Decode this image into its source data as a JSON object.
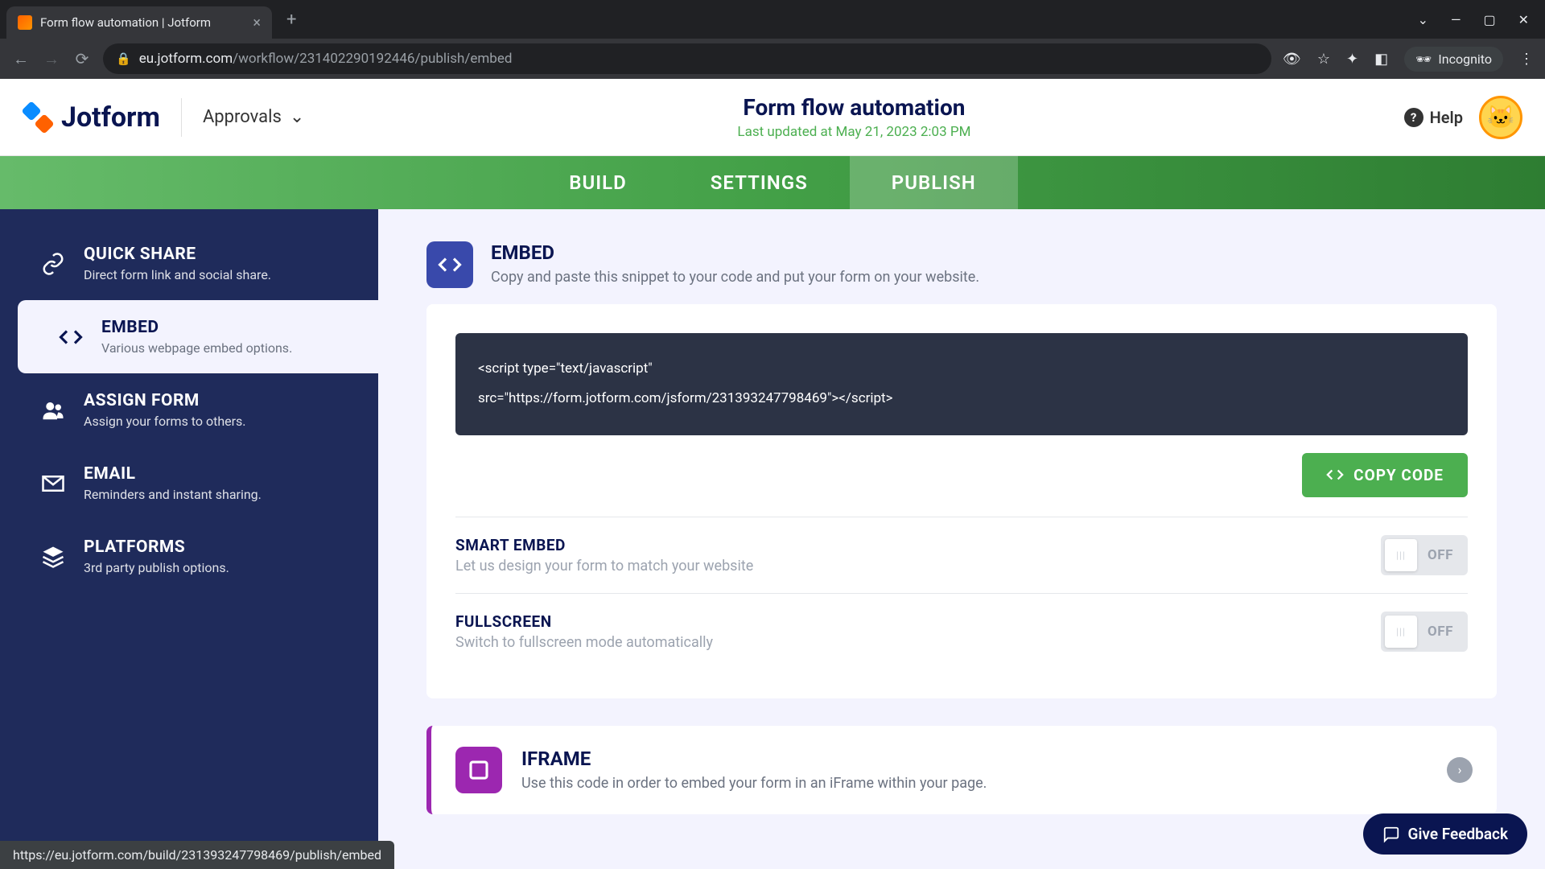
{
  "browser": {
    "tab_title": "Form flow automation | Jotform",
    "url_domain": "eu.jotform.com",
    "url_path": "/workflow/231402290192446/publish/embed",
    "incognito_label": "Incognito",
    "status_url": "https://eu.jotform.com/build/231393247798469/publish/embed"
  },
  "header": {
    "logo_text": "Jotform",
    "dropdown_label": "Approvals",
    "workflow_title": "Form flow automation",
    "last_updated": "Last updated at May 21, 2023 2:03 PM",
    "help_label": "Help"
  },
  "tabs": {
    "build": "BUILD",
    "settings": "SETTINGS",
    "publish": "PUBLISH"
  },
  "sidebar": {
    "items": [
      {
        "title": "QUICK SHARE",
        "sub": "Direct form link and social share."
      },
      {
        "title": "EMBED",
        "sub": "Various webpage embed options."
      },
      {
        "title": "ASSIGN FORM",
        "sub": "Assign your forms to others."
      },
      {
        "title": "EMAIL",
        "sub": "Reminders and instant sharing."
      },
      {
        "title": "PLATFORMS",
        "sub": "3rd party publish options."
      }
    ]
  },
  "embed": {
    "title": "EMBED",
    "desc": "Copy and paste this snippet to your code and put your form on your website.",
    "code_line1": "<script type=\"text/javascript\"",
    "code_line2": "src=\"https://form.jotform.com/jsform/231393247798469\"></script>",
    "copy_label": "COPY CODE",
    "options": [
      {
        "title": "SMART EMBED",
        "desc": "Let us design your form to match your website",
        "state": "OFF"
      },
      {
        "title": "FULLSCREEN",
        "desc": "Switch to fullscreen mode automatically",
        "state": "OFF"
      }
    ]
  },
  "iframe": {
    "title": "IFRAME",
    "desc": "Use this code in order to embed your form in an iFrame within your page."
  },
  "feedback_label": "Give Feedback",
  "colors": {
    "primary_blue": "#0a1551",
    "accent_green": "#4caf50",
    "accent_orange": "#ff6100",
    "purple": "#9c27b0"
  }
}
